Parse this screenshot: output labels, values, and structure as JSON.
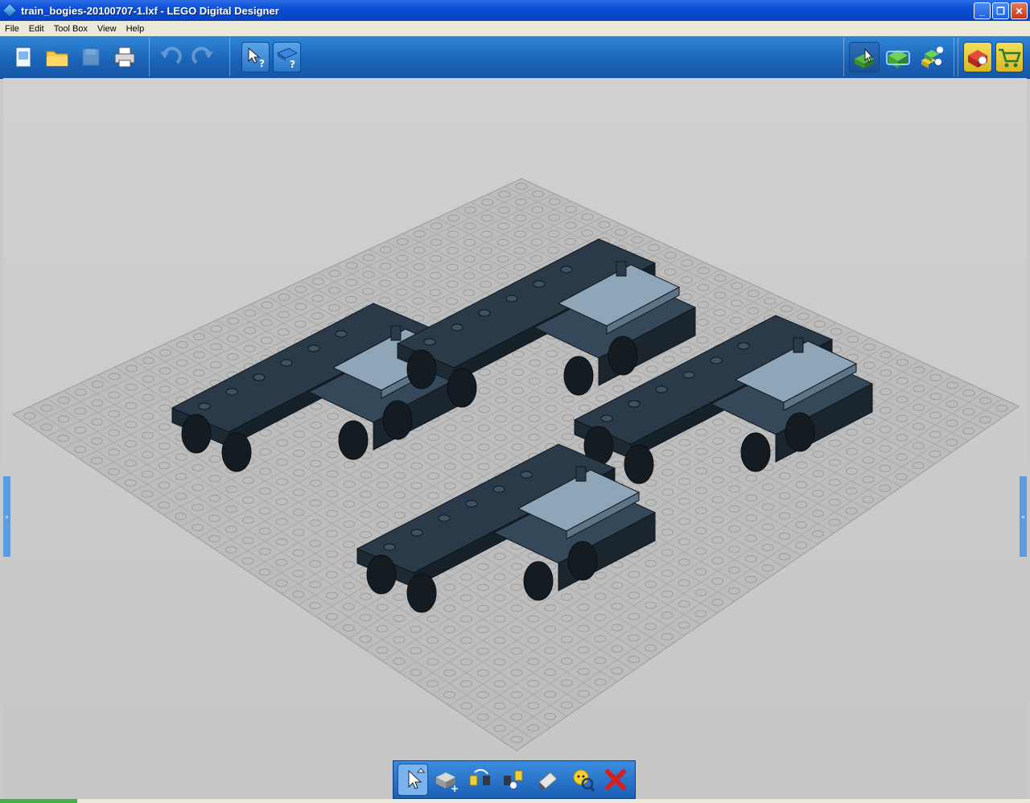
{
  "window": {
    "title": "train_bogies-20100707-1.lxf - LEGO Digital Designer",
    "controls": {
      "minimize": "_",
      "maximize": "❐",
      "close": "✕"
    }
  },
  "menu": [
    "File",
    "Edit",
    "Tool Box",
    "View",
    "Help"
  ],
  "toolbar": {
    "file_group": [
      "new-file-icon",
      "open-folder-icon",
      "save-icon",
      "print-icon"
    ],
    "history_group": [
      "undo-icon",
      "redo-icon"
    ],
    "help_group": [
      "pointer-help-icon",
      "book-help-icon"
    ],
    "mode_group": [
      "build-mode-icon",
      "view-mode-icon",
      "building-guide-mode-icon"
    ],
    "shop_group": [
      "brick-price-icon",
      "shopping-cart-icon"
    ]
  },
  "toolbox": [
    "select-tool-icon",
    "clone-tool-icon",
    "hinge-tool-icon",
    "hinge-align-tool-icon",
    "paint-tool-icon",
    "hide-tool-icon",
    "delete-tool-icon"
  ],
  "colors": {
    "titlebar": "#0a4fd6",
    "toolbar": "#1a63b8",
    "viewport": "#c9c9c9",
    "baseplate": "#bdbdbd",
    "bogie": "#2a3a48",
    "bogie_light": "#8fa6b8"
  }
}
